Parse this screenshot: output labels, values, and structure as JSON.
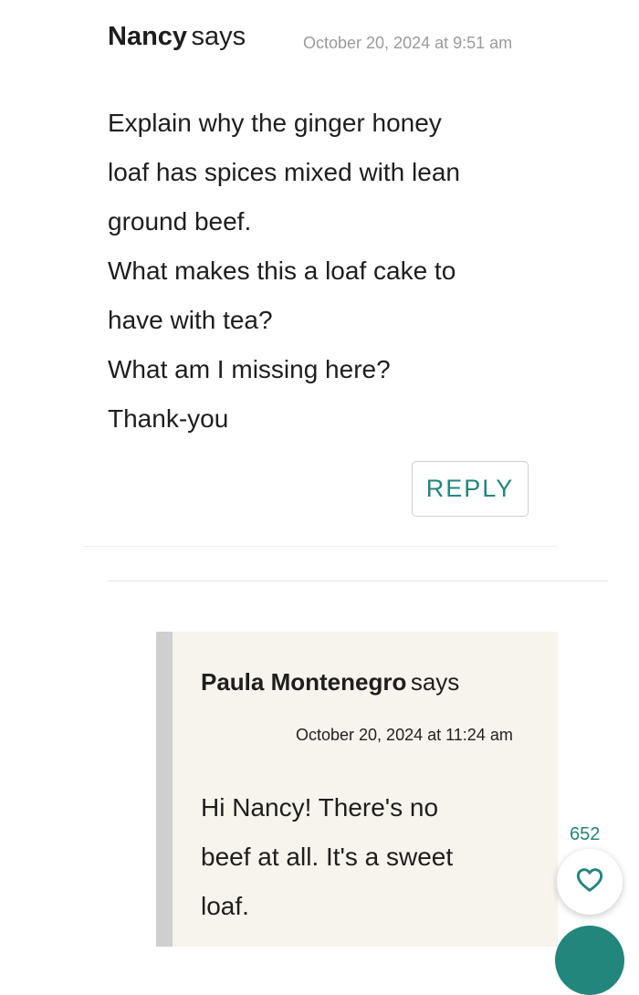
{
  "comment": {
    "author": "Nancy",
    "says": "says",
    "timestamp": "October 20, 2024 at 9:51 am",
    "body_lines": [
      "Explain why the ginger honey",
      "loaf has spices mixed with lean",
      "ground beef.",
      "What makes this a loaf cake to",
      "have with tea?",
      "What am I missing here?",
      "Thank-you"
    ],
    "reply_label": "REPLY"
  },
  "reply": {
    "author": "Paula Montenegro",
    "says": "says",
    "timestamp": "October 20, 2024 at 11:24 am",
    "body_lines": [
      "Hi Nancy! There's no",
      "beef at all. It's a sweet",
      "loaf."
    ]
  },
  "floating": {
    "like_count": "652",
    "like_icon": "heart-icon"
  },
  "colors": {
    "accent": "#23867c",
    "reply_background": "#f6f4ec",
    "reply_bar": "#cfcfcf",
    "timestamp_muted": "#9a9a9a"
  }
}
